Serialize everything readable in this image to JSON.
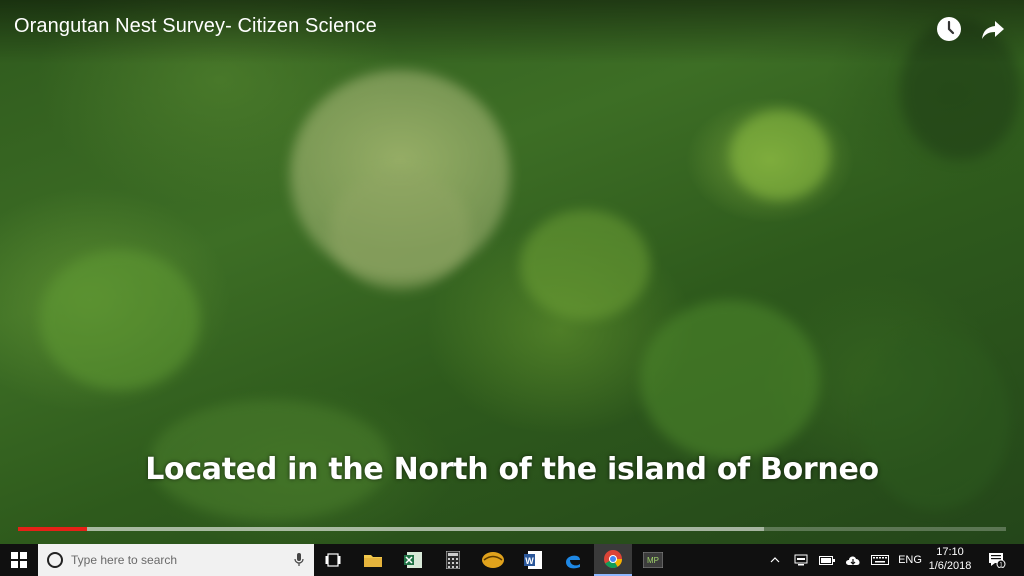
{
  "video": {
    "title": "Orangutan Nest Survey- Citizen Science",
    "caption": "Located in the North of the island of Borneo",
    "played_fraction": 0.07,
    "buffered_fraction": 0.755,
    "accent_color": "#e62117",
    "icons": [
      "clock-icon",
      "share-arrow-icon"
    ]
  },
  "taskbar": {
    "search_placeholder": "Type here to search",
    "apps": [
      "task-view-icon",
      "file-explorer-icon",
      "excel-icon",
      "calculator-icon",
      "outlook-icon",
      "word-icon",
      "edge-icon",
      "chrome-icon",
      "mindjet-icon"
    ],
    "app_labels": {
      "word": "W",
      "mindjet": "MP"
    },
    "active_app": "chrome",
    "tray": {
      "language": "ENG",
      "time": "17:10",
      "date": "1/6/2018",
      "notification_count": "1"
    }
  }
}
